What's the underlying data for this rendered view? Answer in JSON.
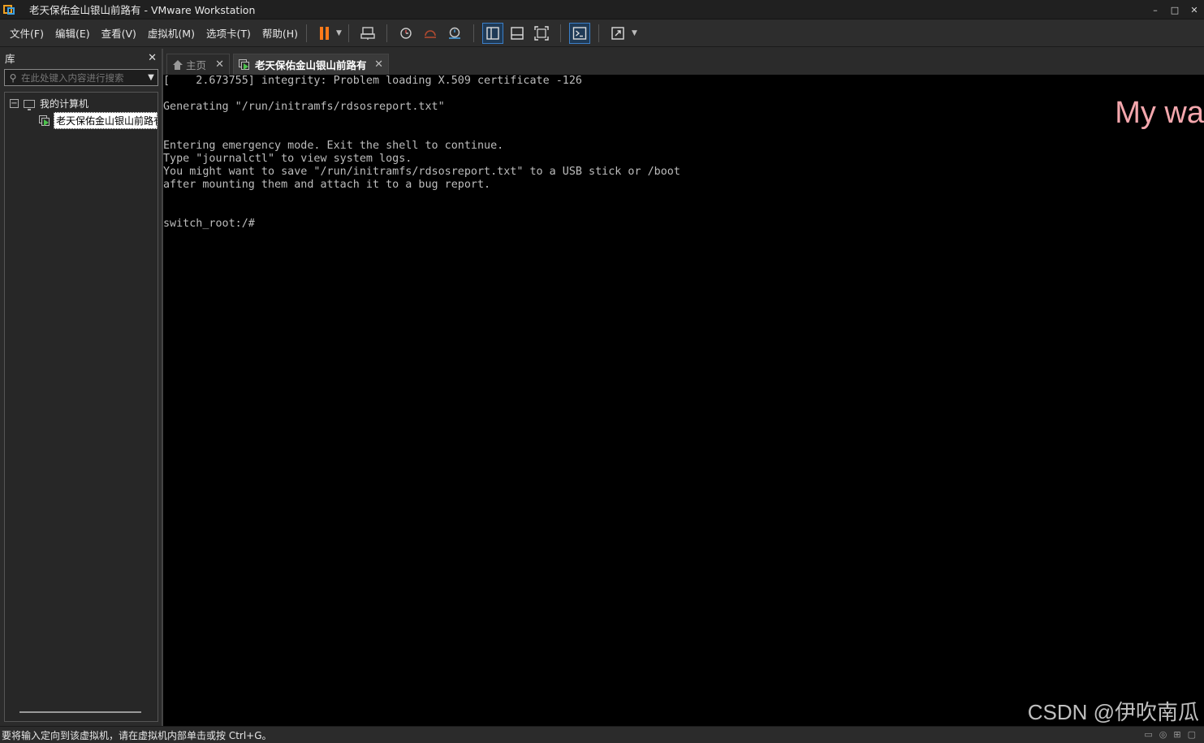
{
  "window": {
    "title": "老天保佑金山银山前路有 - VMware Workstation",
    "controls": {
      "minimize": "–",
      "maximize": "□",
      "close": "✕"
    }
  },
  "menu": {
    "file": "文件(F)",
    "edit": "编辑(E)",
    "view": "查看(V)",
    "vm": "虚拟机(M)",
    "tabs": "选项卡(T)",
    "help": "帮助(H)"
  },
  "toolbar": {
    "accent_color": "#ff7a1a",
    "icons": [
      "pause-icon",
      "send-ctrl-alt-del-icon",
      "snapshot-icon",
      "revert-snapshot-icon",
      "manage-snapshots-icon",
      "show-library-icon",
      "thumbnail-bar-icon",
      "fullscreen-icon",
      "console-view-icon",
      "stretch-icon"
    ]
  },
  "library": {
    "title": "库",
    "close": "✕",
    "search_placeholder": "在此处键入内容进行搜索",
    "tree": {
      "root_label": "我的计算机",
      "expander": "−",
      "vm_label": "老天保佑金山银山前路有"
    }
  },
  "tabs": [
    {
      "label": "主页",
      "close": "✕"
    },
    {
      "label": "老天保佑金山银山前路有",
      "close": "✕"
    }
  ],
  "console": {
    "lines": "[    2.673755] integrity: Problem loading X.509 certificate -126\n\nGenerating \"/run/initramfs/rdsosreport.txt\"\n\n\nEntering emergency mode. Exit the shell to continue.\nType \"journalctl\" to view system logs.\nYou might want to save \"/run/initramfs/rdsosreport.txt\" to a USB stick or /boot\nafter mounting them and attach it to a bug report.\n\n\nswitch_root:/#",
    "overlay_text": "My wa",
    "watermark": "CSDN @伊吹南瓜"
  },
  "status": {
    "message": "要将输入定向到该虚拟机，请在虚拟机内部单击或按 Ctrl+G。"
  }
}
